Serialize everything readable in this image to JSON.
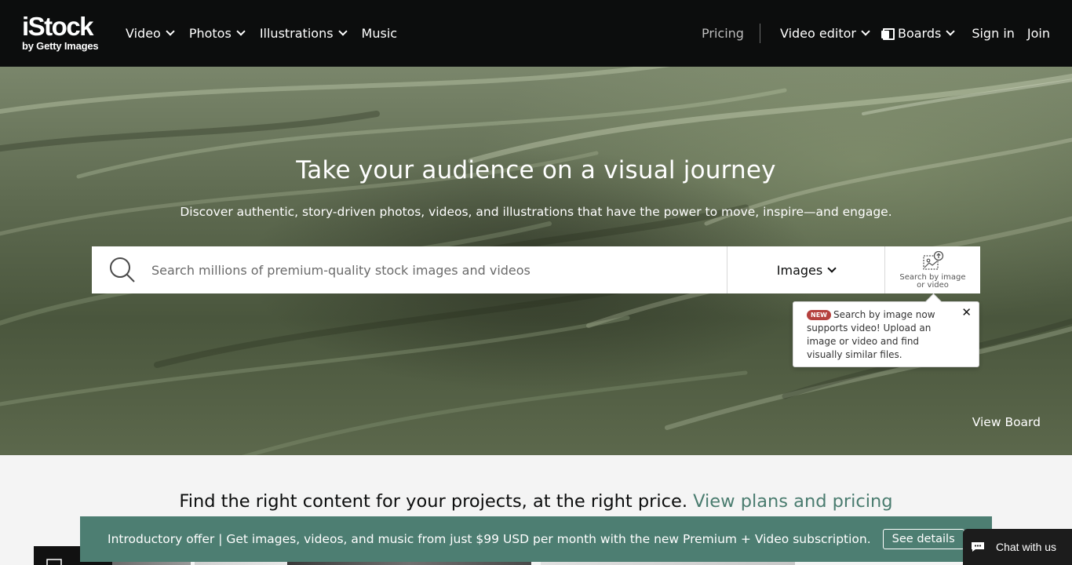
{
  "header": {
    "logo_main": "iStock",
    "logo_sub": "by Getty Images",
    "nav": [
      {
        "label": "Video"
      },
      {
        "label": "Photos"
      },
      {
        "label": "Illustrations"
      },
      {
        "label": "Music"
      }
    ],
    "pricing": "Pricing",
    "video_editor": "Video editor",
    "boards": "Boards",
    "sign_in": "Sign in",
    "join": "Join"
  },
  "hero": {
    "title": "Take your audience on a visual journey",
    "subtitle": "Discover authentic, story-driven photos, videos, and illustrations that have the power to move, inspire—and engage.",
    "view_board": "View Board"
  },
  "search": {
    "placeholder": "Search millions of premium-quality stock images and videos",
    "value": "",
    "type_selected": "Images",
    "image_search_label": "Search by image or video"
  },
  "tooltip": {
    "badge": "NEW",
    "text": "Search by image now supports video! Upload an image or video and find visually similar files.",
    "close": "✕"
  },
  "plans": {
    "text": "Find the right content for your projects, at the right price.",
    "link": "View plans and pricing"
  },
  "promo": {
    "text": "Introductory offer | Get images, videos, and music from just $99 USD per month with the new Premium + Video subscription.",
    "button": "See details"
  },
  "chat": {
    "label": "Chat with us"
  },
  "colors": {
    "header_bg": "#0c0d0d",
    "accent_green": "#4d7e72",
    "link_green": "#4a7c6f",
    "badge_red": "#b5413e"
  },
  "icons": [
    "search-icon",
    "chevron-down-icon",
    "boards-icon",
    "image-search-icon",
    "close-icon",
    "chat-icon"
  ]
}
